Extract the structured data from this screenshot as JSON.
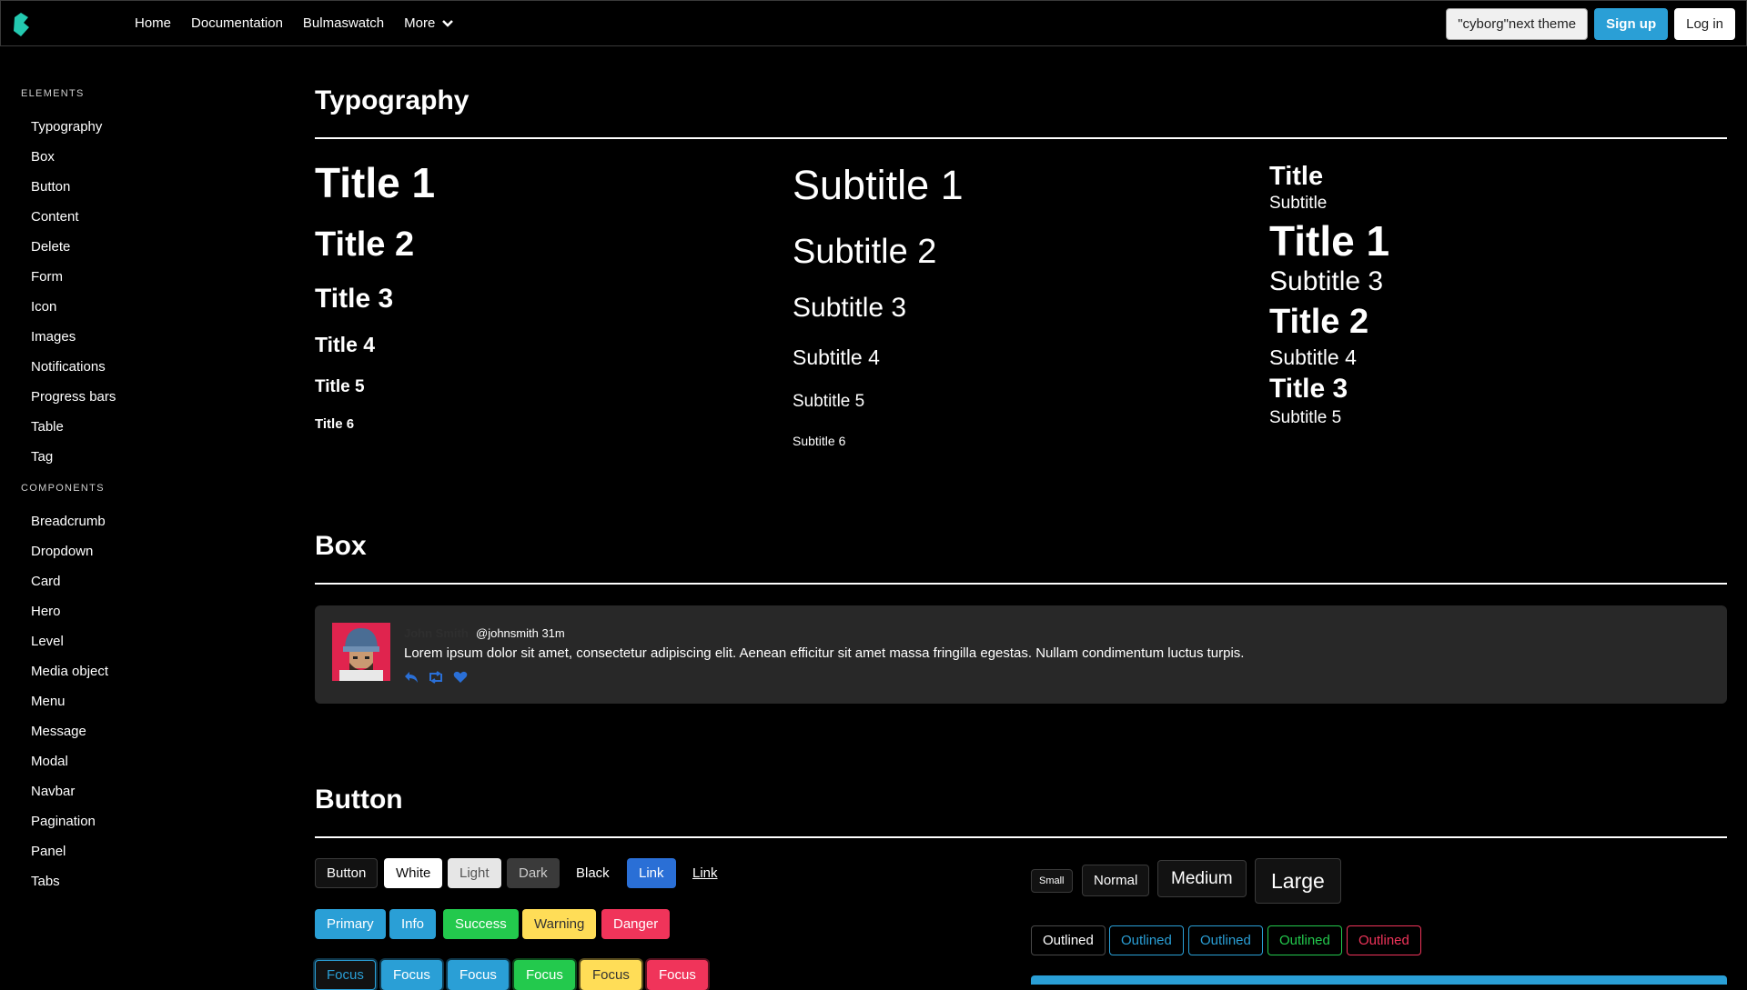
{
  "navbar": {
    "links": [
      "Home",
      "Documentation",
      "Bulmaswatch"
    ],
    "more_label": "More",
    "theme_button": "\"cyborg\"next theme",
    "signup_label": "Sign up",
    "login_label": "Log in"
  },
  "sidebar": {
    "sections": [
      {
        "label": "ELEMENTS",
        "items": [
          "Typography",
          "Box",
          "Button",
          "Content",
          "Delete",
          "Form",
          "Icon",
          "Images",
          "Notifications",
          "Progress bars",
          "Table",
          "Tag"
        ]
      },
      {
        "label": "COMPONENTS",
        "items": [
          "Breadcrumb",
          "Dropdown",
          "Card",
          "Hero",
          "Level",
          "Media object",
          "Menu",
          "Message",
          "Modal",
          "Navbar",
          "Pagination",
          "Panel",
          "Tabs"
        ]
      }
    ]
  },
  "typography": {
    "heading": "Typography",
    "titles": [
      "Title 1",
      "Title 2",
      "Title 3",
      "Title 4",
      "Title 5",
      "Title 6"
    ],
    "subtitles": [
      "Subtitle 1",
      "Subtitle 2",
      "Subtitle 3",
      "Subtitle 4",
      "Subtitle 5",
      "Subtitle 6"
    ],
    "pairs": [
      "Title",
      "Subtitle",
      "Title 1",
      "Subtitle 3",
      "Title 2",
      "Subtitle 4",
      "Title 3",
      "Subtitle 5"
    ]
  },
  "box": {
    "heading": "Box",
    "name": "John Smith",
    "handle": "@johnsmith 31m",
    "text": "Lorem ipsum dolor sit amet, consectetur adipiscing elit. Aenean efficitur sit amet massa fringilla egestas. Nullam condimentum luctus turpis."
  },
  "button": {
    "heading": "Button",
    "row1": [
      "Button",
      "White",
      "Light",
      "Dark",
      "Black",
      "Link",
      "Link"
    ],
    "row2": [
      "Primary",
      "Info",
      "Success",
      "Warning",
      "Danger"
    ],
    "row3": [
      "Focus",
      "Focus",
      "Focus",
      "Focus",
      "Focus",
      "Focus"
    ],
    "sizes": [
      "Small",
      "Normal",
      "Medium",
      "Large"
    ],
    "outlined": [
      "Outlined",
      "Outlined",
      "Outlined",
      "Outlined",
      "Outlined"
    ]
  },
  "colors": {
    "primary": "#2a9fd6",
    "info": "#2a9fd6",
    "link": "#2a6fd6",
    "success": "#23c94d",
    "warning": "#ffdd57",
    "danger": "#f0345a",
    "dark": "#3a3a3a",
    "box_bg": "#282828"
  }
}
